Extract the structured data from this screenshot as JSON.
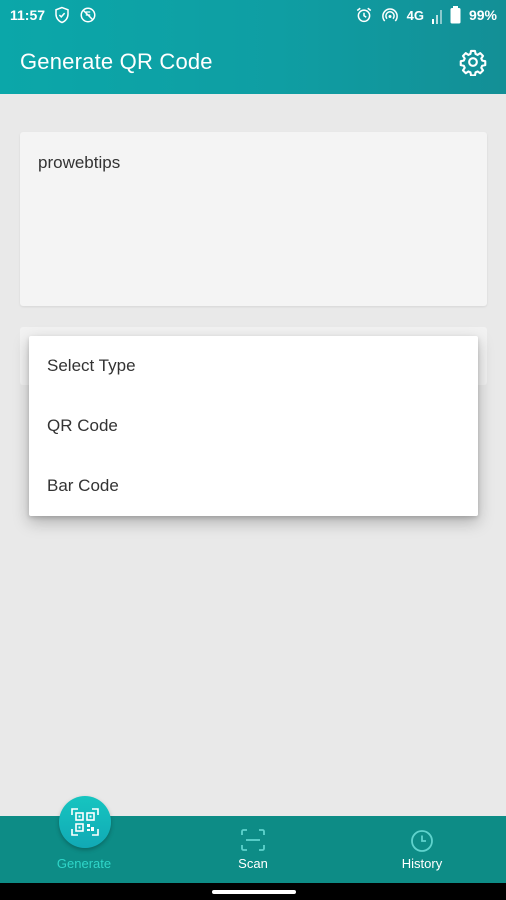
{
  "status_bar": {
    "time": "11:57",
    "network": "4G",
    "battery": "99%",
    "left_icons": [
      "shield-check-icon",
      "data-saver-icon"
    ],
    "right_icons": [
      "alarm-icon",
      "hotspot-icon",
      "signal-icon",
      "battery-icon"
    ]
  },
  "app_bar": {
    "title": "Generate QR Code",
    "settings_icon": "gear-icon"
  },
  "input": {
    "value": "prowebtips"
  },
  "dropdown": {
    "options": [
      "Select Type",
      "QR Code",
      "Bar Code"
    ]
  },
  "bottom_nav": {
    "items": [
      {
        "label": "Generate",
        "icon": "qr-code-icon",
        "active": true
      },
      {
        "label": "Scan",
        "icon": "scan-frame-icon",
        "active": false
      },
      {
        "label": "History",
        "icon": "clock-icon",
        "active": false
      }
    ]
  },
  "colors": {
    "app_bar": "#0ba7a9",
    "bottom_nav": "#0d8c86",
    "active_circle": "#16c5c0",
    "background": "#e9e9e9"
  }
}
